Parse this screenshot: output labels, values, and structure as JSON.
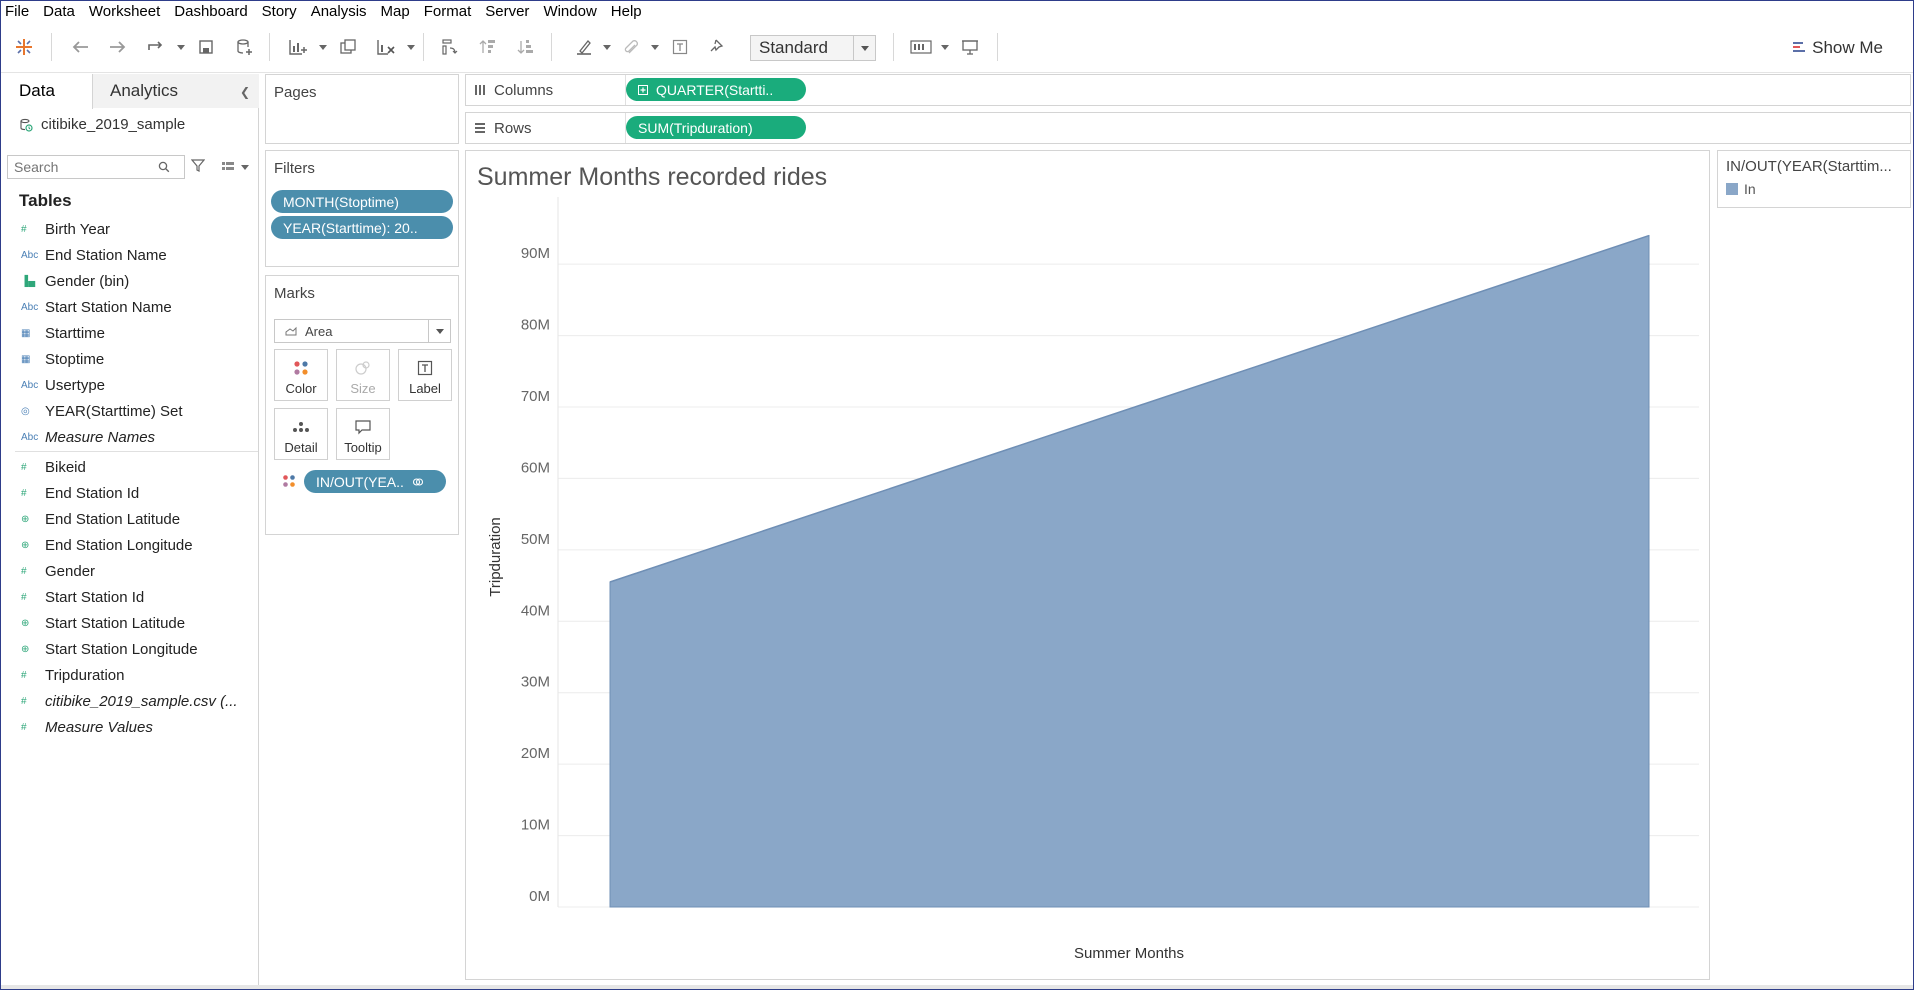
{
  "menu": [
    "File",
    "Data",
    "Worksheet",
    "Dashboard",
    "Story",
    "Analysis",
    "Map",
    "Format",
    "Server",
    "Window",
    "Help"
  ],
  "toolbar": {
    "fit_value": "Standard",
    "show_me_label": "Show Me",
    "icons": [
      "tableau-logo-icon",
      "undo-icon",
      "redo-icon",
      "replay-icon",
      "save-icon",
      "new-datasource-icon",
      "new-worksheet-icon",
      "duplicate-sheet-icon",
      "clear-sheet-icon",
      "swap-icon",
      "sort-ascending-icon",
      "sort-descending-icon",
      "highlight-icon",
      "group-icon",
      "show-labels-icon",
      "pin-icon",
      "show-cards-icon",
      "presentation-icon"
    ]
  },
  "data_pane": {
    "tab_data": "Data",
    "tab_analytics": "Analytics",
    "datasource": "citibike_2019_sample",
    "search_placeholder": "Search",
    "tables_title": "Tables",
    "dimensions": [
      {
        "label": "Birth Year",
        "icon": "#"
      },
      {
        "label": "End Station Name",
        "icon": "Abc"
      },
      {
        "label": "Gender (bin)",
        "icon": "bin"
      },
      {
        "label": "Start Station Name",
        "icon": "Abc"
      },
      {
        "label": "Starttime",
        "icon": "date"
      },
      {
        "label": "Stoptime",
        "icon": "date"
      },
      {
        "label": "Usertype",
        "icon": "Abc"
      },
      {
        "label": "YEAR(Starttime) Set",
        "icon": "set"
      },
      {
        "label": "Measure Names",
        "icon": "Abc",
        "italic": true
      }
    ],
    "measures": [
      {
        "label": "Bikeid",
        "icon": "#"
      },
      {
        "label": "End Station Id",
        "icon": "#"
      },
      {
        "label": "End Station Latitude",
        "icon": "geo"
      },
      {
        "label": "End Station Longitude",
        "icon": "geo"
      },
      {
        "label": "Gender",
        "icon": "#"
      },
      {
        "label": "Start Station Id",
        "icon": "#"
      },
      {
        "label": "Start Station Latitude",
        "icon": "geo"
      },
      {
        "label": "Start Station Longitude",
        "icon": "geo"
      },
      {
        "label": "Tripduration",
        "icon": "#"
      },
      {
        "label": "citibike_2019_sample.csv (...",
        "icon": "#",
        "italic": true
      },
      {
        "label": "Measure Values",
        "icon": "#",
        "italic": true
      }
    ]
  },
  "pages_title": "Pages",
  "filters": {
    "title": "Filters",
    "pills": [
      "MONTH(Stoptime)",
      "YEAR(Starttime): 20.."
    ]
  },
  "marks": {
    "title": "Marks",
    "type": "Area",
    "buttons": [
      "Color",
      "Size",
      "Label",
      "Detail",
      "Tooltip"
    ],
    "color_pill": "IN/OUT(YEA.."
  },
  "columns": {
    "label": "Columns",
    "pill": "QUARTER(Startti.."
  },
  "rows": {
    "label": "Rows",
    "pill": "SUM(Tripduration)"
  },
  "legend": {
    "title": "IN/OUT(YEAR(Starttim...",
    "items": [
      {
        "label": "In",
        "color": "#8aa7c8"
      }
    ]
  },
  "colors": {
    "area_fill": "#8aa7c8",
    "area_stroke": "#6f8fb5",
    "pill_blue": "#4b8eac",
    "pill_green": "#1aac7c"
  },
  "chart_data": {
    "type": "area",
    "title": "Summer Months recorded rides",
    "xlabel": "Summer Months",
    "ylabel": "Tripduration",
    "x": [
      "start",
      "end"
    ],
    "values": [
      45500000,
      94000000
    ],
    "ylim": [
      0,
      98000000
    ],
    "yticks": [
      0,
      10000000,
      20000000,
      30000000,
      40000000,
      50000000,
      60000000,
      70000000,
      80000000,
      90000000
    ],
    "ytick_labels": [
      "0M",
      "10M",
      "20M",
      "30M",
      "40M",
      "50M",
      "60M",
      "70M",
      "80M",
      "90M"
    ],
    "grid": true,
    "legend": "right"
  }
}
